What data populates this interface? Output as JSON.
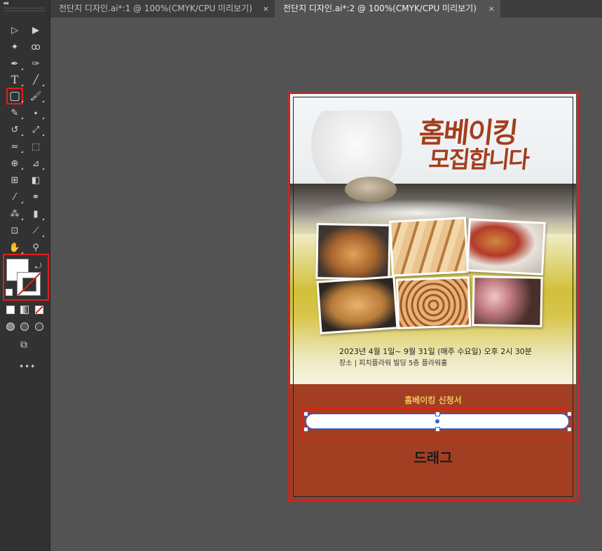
{
  "tabs": [
    {
      "label": "전단지 디자인.ai*:1 @ 100%(CMYK/CPU 미리보기)",
      "close": "×"
    },
    {
      "label": "전단지 디자인.ai*:2 @ 100%(CMYK/CPU 미리보기)",
      "close": "×"
    }
  ],
  "toolbar": {
    "collapse": "◂◂",
    "more": "•••",
    "tools": [
      {
        "name": "selection-tool-icon",
        "glyph": "▷"
      },
      {
        "name": "direct-selection-tool-icon",
        "glyph": "▶"
      },
      {
        "name": "magic-wand-tool-icon",
        "glyph": "✦"
      },
      {
        "name": "lasso-tool-icon",
        "glyph": "ꝏ"
      },
      {
        "name": "pen-tool-icon",
        "glyph": "✒"
      },
      {
        "name": "curvature-tool-icon",
        "glyph": "✑"
      },
      {
        "name": "type-tool-icon",
        "glyph": "T"
      },
      {
        "name": "line-segment-tool-icon",
        "glyph": "╱"
      },
      {
        "name": "rounded-rectangle-tool-icon",
        "glyph": "▢"
      },
      {
        "name": "paintbrush-tool-icon",
        "glyph": "🖌"
      },
      {
        "name": "shaper-tool-icon",
        "glyph": "✎"
      },
      {
        "name": "eraser-tool-icon",
        "glyph": "⬩"
      },
      {
        "name": "rotate-tool-icon",
        "glyph": "↺"
      },
      {
        "name": "scale-tool-icon",
        "glyph": "⤢"
      },
      {
        "name": "width-tool-icon",
        "glyph": "≈"
      },
      {
        "name": "free-transform-tool-icon",
        "glyph": "⬚"
      },
      {
        "name": "shape-builder-tool-icon",
        "glyph": "⊕"
      },
      {
        "name": "perspective-grid-tool-icon",
        "glyph": "⊿"
      },
      {
        "name": "mesh-tool-icon",
        "glyph": "⊞"
      },
      {
        "name": "gradient-tool-icon",
        "glyph": "◧"
      },
      {
        "name": "eyedropper-tool-icon",
        "glyph": "⁄"
      },
      {
        "name": "blend-tool-icon",
        "glyph": "⚭"
      },
      {
        "name": "symbol-sprayer-tool-icon",
        "glyph": "⁂"
      },
      {
        "name": "column-graph-tool-icon",
        "glyph": "▮"
      },
      {
        "name": "artboard-tool-icon",
        "glyph": "⊡"
      },
      {
        "name": "slice-tool-icon",
        "glyph": "⟋"
      },
      {
        "name": "hand-tool-icon",
        "glyph": "✋"
      },
      {
        "name": "zoom-tool-icon",
        "glyph": "⚲"
      }
    ]
  },
  "flyer": {
    "title_line1": "홈베이킹",
    "title_line2": "모집합니다",
    "date_line": "2023년 4월 1일~ 9월 31일 (매주 수요일) 오후 2시 30분",
    "place_line": "장소 |  피치플라워 빌딩 5층 플라워홀",
    "apply_title": "홈베이킹 신청서",
    "field_placeholder": "",
    "drag_label": "드래그"
  },
  "colors": {
    "flyer_brown": "#a23f23",
    "title_brown": "#a33e1d",
    "apply_gold": "#f2c55a",
    "selection_blue": "#3b62d9",
    "highlight_red": "#e0201c"
  },
  "photos": [
    {
      "name": "photo-bread-rolls",
      "color": "#c98a45"
    },
    {
      "name": "photo-sliced-loaf",
      "color": "#d7a56d"
    },
    {
      "name": "photo-cookies-milk",
      "color": "#b86b3a"
    },
    {
      "name": "photo-braided-bread",
      "color": "#c98e4d"
    },
    {
      "name": "photo-cinnamon-roll",
      "color": "#d9a066"
    },
    {
      "name": "photo-cupcakes",
      "color": "#c98b92"
    }
  ]
}
